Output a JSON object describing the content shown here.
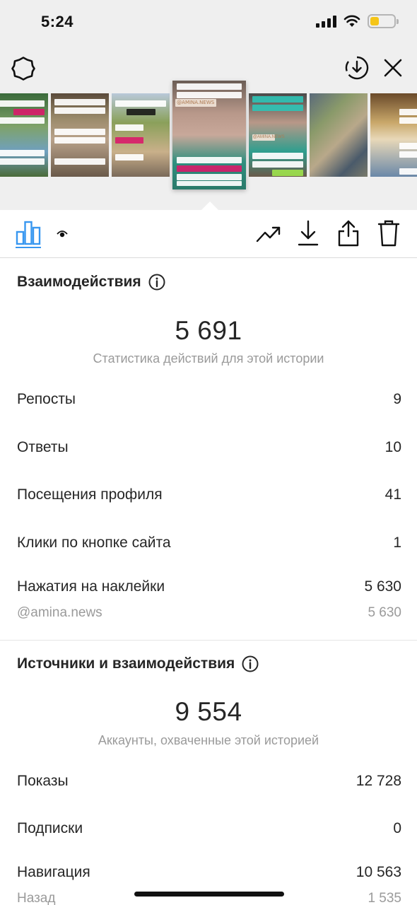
{
  "status_bar": {
    "time": "5:24",
    "icons": [
      "signal-icon",
      "wifi-icon",
      "battery-icon"
    ],
    "battery_color": "#f5c518"
  },
  "header": {
    "left_icon": "gear-icon",
    "right_icons": [
      "download-circle-icon",
      "close-icon"
    ]
  },
  "stories": {
    "thumbnails": [
      {
        "name": "story-thumb-1"
      },
      {
        "name": "story-thumb-2"
      },
      {
        "name": "story-thumb-3"
      },
      {
        "name": "story-thumb-current",
        "watermark": "@AMINA.NEWS"
      },
      {
        "name": "story-thumb-5",
        "watermark": "@AMINA.NEWS"
      },
      {
        "name": "story-thumb-6"
      },
      {
        "name": "story-thumb-7"
      }
    ]
  },
  "toolbar": {
    "tabs": [
      "bar-chart-icon",
      "eye-icon"
    ],
    "actions": [
      "trend-icon",
      "download-icon",
      "share-icon",
      "trash-icon"
    ],
    "active_color": "#3897f0"
  },
  "interactions": {
    "title": "Взаимодействия",
    "total": "5 691",
    "total_caption": "Статистика действий для этой истории",
    "rows": [
      {
        "label": "Репосты",
        "value": "9"
      },
      {
        "label": "Ответы",
        "value": "10"
      },
      {
        "label": "Посещения профиля",
        "value": "41"
      },
      {
        "label": "Клики по кнопке сайта",
        "value": "1"
      },
      {
        "label": "Нажатия на наклейки",
        "value": "5 630"
      }
    ],
    "sticker_sub": {
      "label": "@amina.news",
      "value": "5 630"
    }
  },
  "discovery": {
    "title": "Источники и взаимодействия",
    "total": "9 554",
    "total_caption": "Аккаунты, охваченные этой историей",
    "rows": [
      {
        "label": "Показы",
        "value": "12 728"
      },
      {
        "label": "Подписки",
        "value": "0"
      },
      {
        "label": "Навигация",
        "value": "10 563"
      }
    ],
    "nav_sub": {
      "label": "Назад",
      "value": "1 535"
    }
  }
}
